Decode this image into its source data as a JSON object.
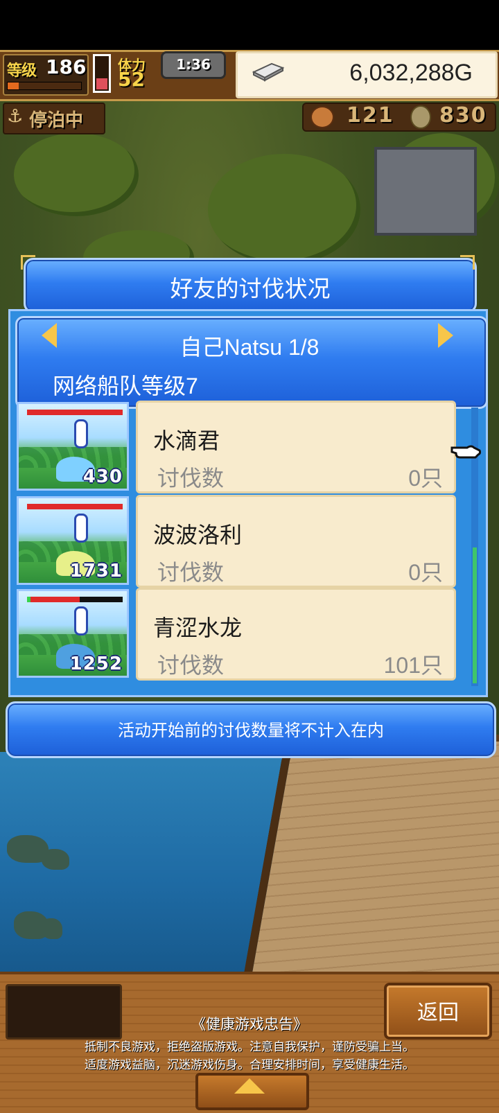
{
  "status_bar": {
    "level_label": "等级",
    "level_value": "186",
    "exp_progress": 0.15,
    "stamina_label": "体力",
    "stamina_value": "52",
    "stamina_fill": 0.35,
    "timer": "1:36",
    "gold": "6,032,288G"
  },
  "status_row2": {
    "docked_label": "停泊中",
    "resource1_value": "121",
    "resource2_value": "830"
  },
  "dialog": {
    "title": "好友的讨伐状况",
    "header_title": "自己Natsu 1/8",
    "header_subtitle": "网络船队等级7",
    "rows": [
      {
        "name": "水滴君",
        "kill_label": "讨伐数",
        "kill_value": "0只",
        "monster_number": "430",
        "hp_fraction": 1.0,
        "color": "#7fd0ff"
      },
      {
        "name": "波波洛利",
        "kill_label": "讨伐数",
        "kill_value": "0只",
        "monster_number": "1731",
        "hp_fraction": 1.0,
        "color": "#e7f08a"
      },
      {
        "name": "青涩水龙",
        "kill_label": "讨伐数",
        "kill_value": "101只",
        "monster_number": "1252",
        "hp_fraction": 0.55,
        "color": "#4fa0e0"
      }
    ],
    "note": "活动开始前的讨伐数量将不计入在内"
  },
  "footer": {
    "back_label": "返回",
    "advice_title": "《健康游戏忠告》",
    "advice_line1": "抵制不良游戏，拒绝盗版游戏。注意自我保护，谨防受骗上当。",
    "advice_line2": "适度游戏益脑，沉迷游戏伤身。合理安排时间，享受健康生活。"
  }
}
